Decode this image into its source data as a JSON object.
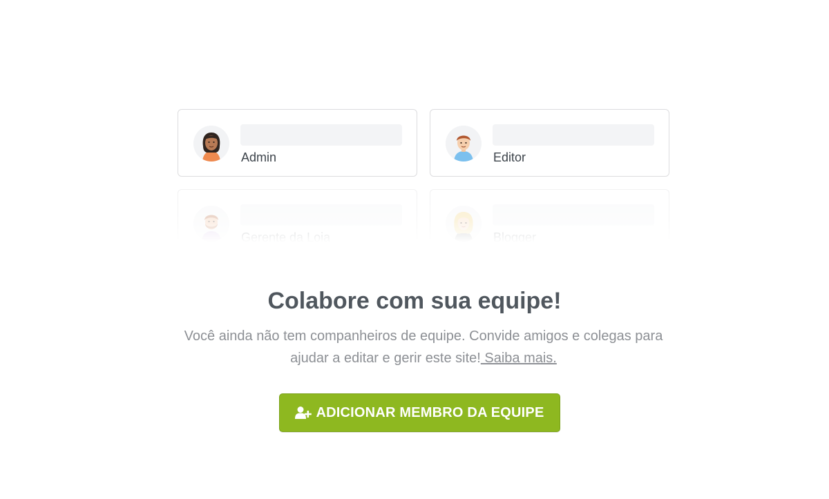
{
  "team_cards": [
    {
      "role": "Admin",
      "avatar": "woman-avatar-icon"
    },
    {
      "role": "Editor",
      "avatar": "man-avatar-icon"
    },
    {
      "role": "Gerente da Loja",
      "avatar": "bearded-man-avatar-icon"
    },
    {
      "role": "Blogger",
      "avatar": "blonde-woman-avatar-icon"
    }
  ],
  "empty_state": {
    "title": "Colabore com sua equipe!",
    "description_line1": "Você ainda não tem companheiros de equipe. Convide amigos e colegas para",
    "description_line2": "ajudar a editar e gerir este site!",
    "learn_more_link": " Saiba mais."
  },
  "add_button": {
    "label": "ADICIONAR MEMBRO DA EQUIPE",
    "icon": "add-user-icon",
    "color": "#8eb820"
  },
  "colors": {
    "title": "#50575e",
    "text_muted": "#8c8f94",
    "card_border": "#dcdcde",
    "placeholder_bar": "#f3f4f6"
  }
}
